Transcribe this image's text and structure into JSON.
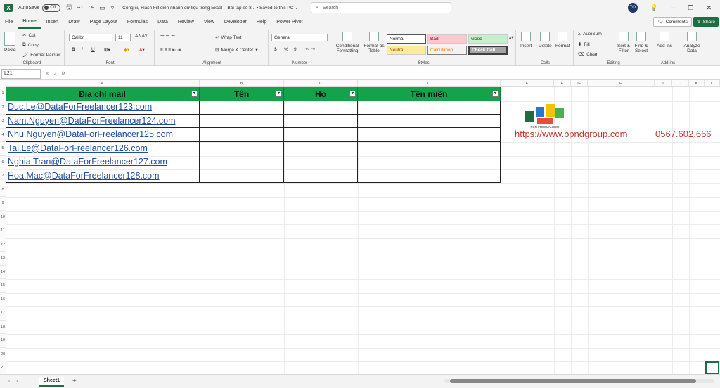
{
  "titlebar": {
    "autosave_label": "AutoSave",
    "autosave_state": "Off",
    "doc_title": "Công cụ Flash Fill điền nhanh dữ liệu trong Excel – Bài tập số 8... • Saved to this PC ⌄",
    "search_placeholder": "Search",
    "user_initials": "TO"
  },
  "menu": {
    "tabs": [
      "File",
      "Home",
      "Insert",
      "Draw",
      "Page Layout",
      "Formulas",
      "Data",
      "Review",
      "View",
      "Developer",
      "Help",
      "Power Pivot"
    ],
    "active": "Home",
    "comments": "Comments",
    "share": "Share"
  },
  "ribbon": {
    "clipboard": {
      "paste": "Paste",
      "cut": "Cut",
      "copy": "Copy",
      "format_painter": "Format Painter",
      "label": "Clipboard"
    },
    "font": {
      "name": "Calibri",
      "size": "11",
      "label": "Font",
      "bold": "B",
      "italic": "I",
      "underline": "U"
    },
    "alignment": {
      "wrap": "Wrap Text",
      "merge": "Merge & Center",
      "label": "Alignment"
    },
    "number": {
      "format": "General",
      "label": "Number",
      "currency": "$",
      "percent": "%",
      "comma": "9"
    },
    "styles": {
      "conditional": "Conditional Formatting",
      "format_table": "Format as Table",
      "normal": "Normal",
      "bad": "Bad",
      "good": "Good",
      "neutral": "Neutral",
      "calculation": "Calculation",
      "check_cell": "Check Cell",
      "label": "Styles"
    },
    "cells": {
      "insert": "Insert",
      "delete": "Delete",
      "format": "Format",
      "label": "Cells"
    },
    "editing": {
      "autosum": "AutoSum",
      "fill": "Fill",
      "clear": "Clear",
      "sort": "Sort & Filter",
      "find": "Find & Select",
      "label": "Editing"
    },
    "addins": {
      "addins": "Add-ins",
      "analyze": "Analyze Data",
      "label": "Add-ins"
    }
  },
  "formula_bar": {
    "cell_ref": "L21",
    "fx": "fx",
    "content": ""
  },
  "sheet": {
    "columns": [
      "A",
      "B",
      "C",
      "D",
      "E",
      "F",
      "G",
      "H",
      "I",
      "J",
      "K",
      "L"
    ],
    "rows": [
      "1",
      "2",
      "3",
      "4",
      "5",
      "6",
      "7",
      "8",
      "9",
      "10",
      "11",
      "12",
      "13",
      "14",
      "15",
      "16",
      "17",
      "18",
      "19",
      "20",
      "21"
    ],
    "table_headers": [
      "Địa chỉ mail",
      "Tên",
      "Họ",
      "Tên miền"
    ],
    "emails": [
      "Duc.Le@DataForFreelancer123.com",
      "Nam.Nguyen@DataForFreelancer124.com",
      "Nhu.Nguyen@DataForFreelancer125.com",
      "Tai.Le@DataForFreelancer126.com",
      "Nghia.Tran@DataForFreelancer127.com",
      "Hoa.Mac@DataForFreelancer128.com"
    ],
    "url": "https://www.bpndgroup.com",
    "phone": "0567.602.666",
    "logo_text": "FOR FREELANCER"
  },
  "status": {
    "sheet_tab": "Sheet1",
    "add": "+"
  },
  "colors": {
    "excel_green": "#1d6f42",
    "table_header": "#14a34a",
    "link": "#1f4e9e",
    "accent_red": "#c0392b"
  }
}
